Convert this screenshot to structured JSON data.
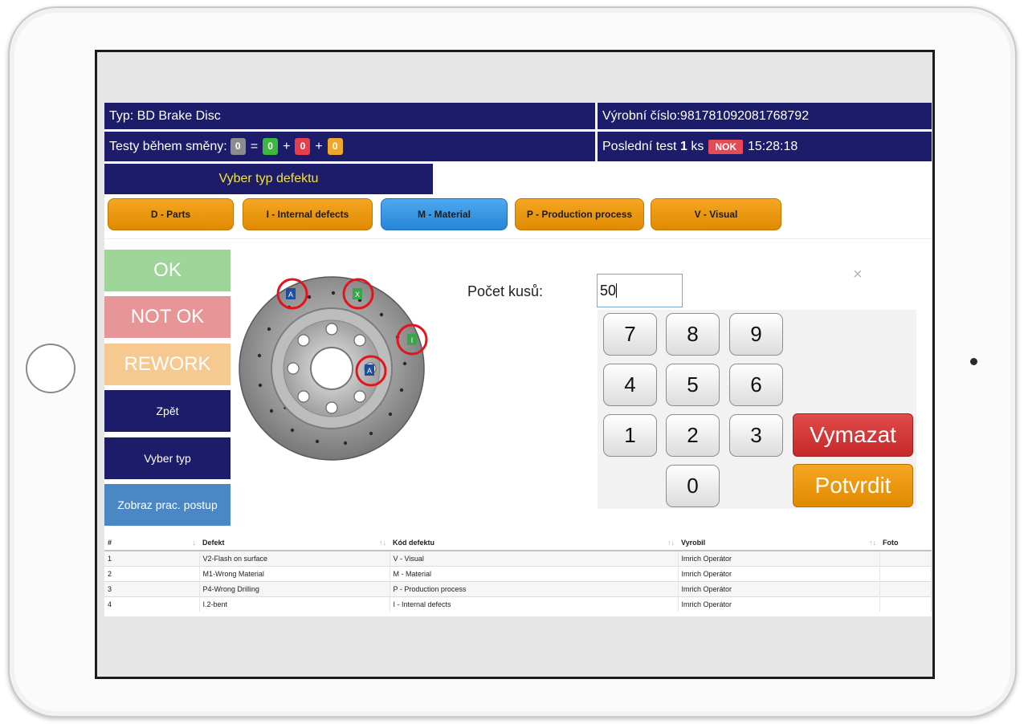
{
  "header": {
    "typ": "Typ: BD Brake Disc",
    "vyrobni_cislo": "Výrobní číslo:981781092081768792",
    "testy_label": "Testy během směny:",
    "testy_counts": {
      "total": "0",
      "ok": "0",
      "nok": "0",
      "rework": "0"
    },
    "posledni_test_prefix": "Poslední test",
    "posledni_test_qty": "1",
    "posledni_test_unit": "ks",
    "posledni_test_status": "NOK",
    "posledni_test_time": "15:28:18"
  },
  "defect_type_title": "Vyber typ defektu",
  "categories": [
    {
      "label": "D - Parts",
      "active": false
    },
    {
      "label": "I - Internal defects",
      "active": false
    },
    {
      "label": "M - Material",
      "active": true
    },
    {
      "label": "P - Production process",
      "active": false
    },
    {
      "label": "V - Visual",
      "active": false
    }
  ],
  "actions": {
    "ok": "OK",
    "not_ok": "NOT OK",
    "rework": "REWORK",
    "zpet": "Zpět",
    "vyber_typ": "Vyber typ",
    "zobraz": "Zobraz prac. postup"
  },
  "disc_markers": [
    "A",
    "X",
    "I",
    "A"
  ],
  "count": {
    "label": "Počet kusů:",
    "value": "50",
    "close": "×"
  },
  "keypad": {
    "keys": [
      "7",
      "8",
      "9",
      "4",
      "5",
      "6",
      "1",
      "2",
      "3",
      "0"
    ],
    "clear": "Vymazat",
    "confirm": "Potvrdit"
  },
  "table": {
    "headers": [
      "#",
      "Defekt",
      "Kód defektu",
      "Vyrobil",
      "Foto"
    ],
    "rows": [
      [
        "1",
        "V2-Flash on surface",
        "V - Visual",
        "Imrich Operátor",
        ""
      ],
      [
        "2",
        "M1-Wrong Material",
        "M - Material",
        "Imrich Operátor",
        ""
      ],
      [
        "3",
        "P4-Wrong Drilling",
        "P - Production process",
        "Imrich Operátor",
        ""
      ],
      [
        "4",
        "I.2-bent",
        "I - Internal defects",
        "Imrich Operátor",
        ""
      ]
    ]
  },
  "colors": {
    "navy": "#1c1c6b",
    "title_yellow": "#f4e23c",
    "orange": "#f5a623",
    "blue_active": "#3b97e4",
    "ok_green": "#9ed69a",
    "notok_red": "#e79597",
    "rework_orange": "#f5c98f",
    "clear_red": "#d43636"
  }
}
